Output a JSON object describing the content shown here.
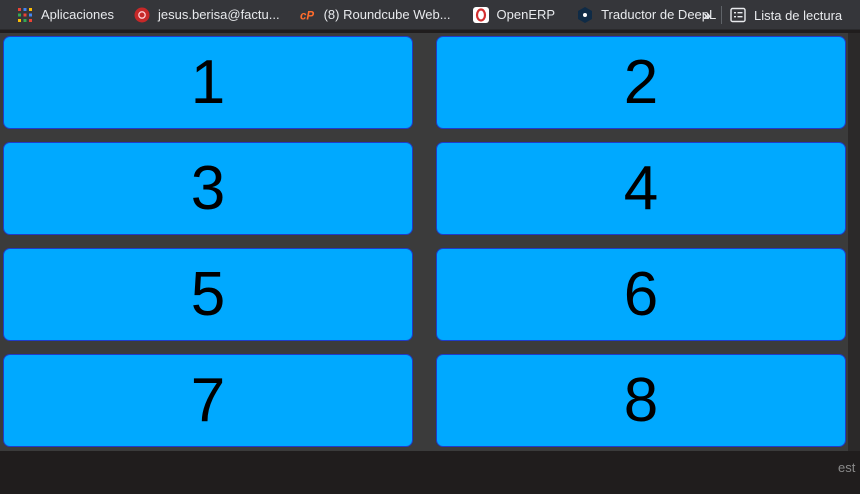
{
  "bookmarks": [
    {
      "label": "Aplicaciones",
      "icon": "apps-grid-icon"
    },
    {
      "label": "jesus.berisa@factu...",
      "icon": "mail-icon"
    },
    {
      "label": "(8) Roundcube Web...",
      "icon": "cpanel-icon"
    },
    {
      "label": "OpenERP",
      "icon": "openerp-icon"
    },
    {
      "label": "Traductor de DeepL",
      "icon": "deepl-icon"
    }
  ],
  "overflow_label": "»",
  "reading_list_label": "Lista de lectura",
  "tiles": [
    "1",
    "2",
    "3",
    "4",
    "5",
    "6",
    "7",
    "8"
  ],
  "edge_text": "est",
  "colors": {
    "tile_bg": "#00a9ff",
    "tile_border": "#1f3cc9",
    "panel_bg": "#3b3b3b",
    "bar_bg": "#35363a"
  }
}
